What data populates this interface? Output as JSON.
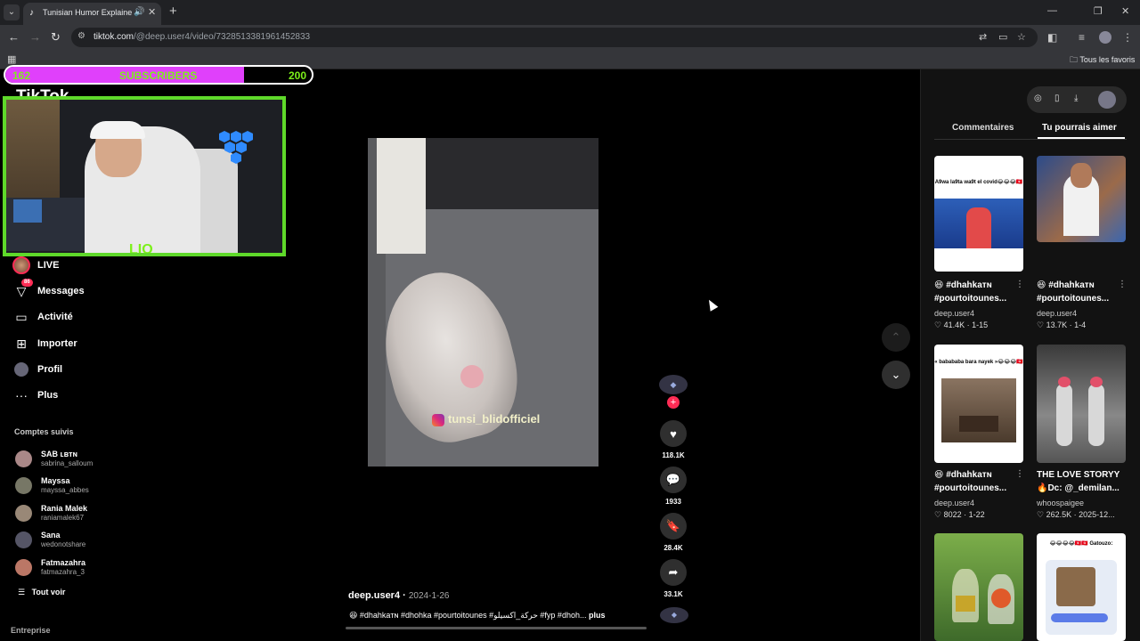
{
  "browser": {
    "tab_title": "Tunisian Humor Explained:",
    "url_host": "tiktok.com",
    "url_path": "/@deep.user4/video/7328513381961452833",
    "bookmarks_folder": "Tous les favoris"
  },
  "overlay": {
    "sub_start": "162",
    "sub_label": "SUBSCRIBERS",
    "sub_end": "200",
    "sub_progress": 0.78,
    "webcam_logo": "LIO"
  },
  "sidebar": {
    "logo": "TikTok",
    "nav": [
      {
        "label": "LIVE"
      },
      {
        "label": "Messages",
        "badge": "86"
      },
      {
        "label": "Activité"
      },
      {
        "label": "Importer"
      },
      {
        "label": "Profil"
      },
      {
        "label": "Plus"
      }
    ],
    "following_title": "Comptes suivis",
    "following": [
      {
        "name": "SAB ʟʙᴛɴ",
        "user": "sabrina_salloum"
      },
      {
        "name": "Mayssa",
        "user": "mayssa_abbes"
      },
      {
        "name": "Rania Malek",
        "user": "raniamalek67"
      },
      {
        "name": "Sana",
        "user": "wedonotshare"
      },
      {
        "name": "Fatmazahra",
        "user": "fatmazahra_3"
      }
    ],
    "see_all": "Tout voir",
    "footer": "Entreprise"
  },
  "video": {
    "watermark": "tunsi_blidofficiel",
    "author": "deep.user4",
    "date": "2024-1-26",
    "caption": "😆 #dhahkaᴛɴ #dhohka #pourtoitounes #حركة_اكسيلو #fyp #dhoh...",
    "caption_more": "plus",
    "progress": 0.0
  },
  "actions": {
    "likes": "118.1K",
    "comments": "1933",
    "saves": "28.4K",
    "shares": "33.1K"
  },
  "panel": {
    "tab_comments": "Commentaires",
    "tab_suggest": "Tu pourrais aimer",
    "cards": [
      {
        "thumb_text": "A9wa la9ta wa9t el covid😂😂😂🇹🇳",
        "title": "😆 #dhahkaᴛɴ",
        "title2": "#pourtoitounes...",
        "author": "deep.user4",
        "likes": "41.4K",
        "date": "1-15"
      },
      {
        "thumb_text": "",
        "title": "😆 #dhahkaᴛɴ",
        "title2": "#pourtoitounes...",
        "author": "deep.user4",
        "likes": "13.7K",
        "date": "1-4"
      },
      {
        "thumb_text": "« babababa bara nayek »😂😂😂🇹🇳",
        "title": "😆 #dhahkaᴛɴ",
        "title2": "#pourtoitounes...",
        "author": "deep.user4",
        "likes": "8022",
        "date": "1-22"
      },
      {
        "thumb_text": "",
        "title": "THE LOVE STORYY",
        "title2": "🔥Dc: @_demilan...",
        "author": "whoospaigee",
        "likes": "262.5K",
        "date": "2025-12..."
      },
      {
        "thumb_text": "",
        "title": "",
        "title2": "",
        "author": "",
        "likes": "",
        "date": ""
      },
      {
        "thumb_text": "😂😂😂😂🇹🇳🇹🇳 Gatouzo:",
        "title": "",
        "title2": "",
        "author": "",
        "likes": "",
        "date": ""
      }
    ]
  },
  "colors": {
    "accent": "#fe2c55",
    "sub_fill": "#e040fb",
    "sub_text": "#7cf01a",
    "webcam_border": "#5fd92a"
  }
}
